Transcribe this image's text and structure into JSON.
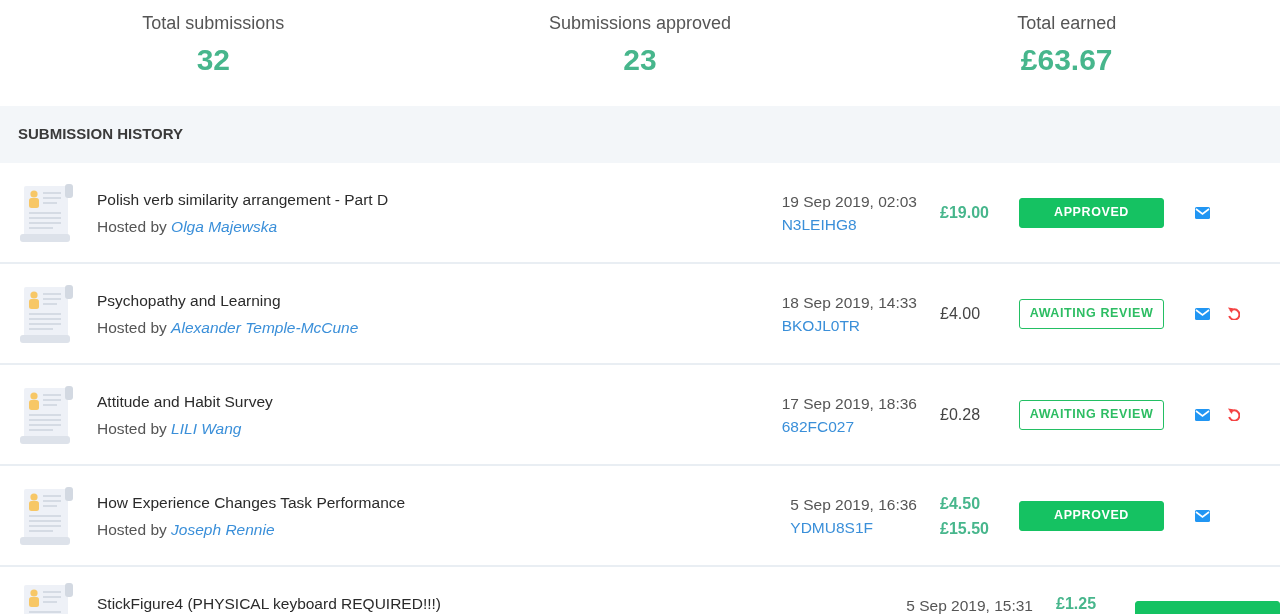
{
  "stats": [
    {
      "label": "Total submissions",
      "value": "32"
    },
    {
      "label": "Submissions approved",
      "value": "23"
    },
    {
      "label": "Total earned",
      "value": "£63.67"
    }
  ],
  "history": {
    "title": "SUBMISSION HISTORY",
    "rows": [
      {
        "title": "Polish verb similarity arrangement - Part D",
        "host_prefix": "Hosted by",
        "host": "Olga Majewska",
        "date": "19 Sep 2019, 02:03",
        "code": "N3LEIHG8",
        "amounts": [
          "£19.00"
        ],
        "badge": {
          "kind": "approved",
          "label": "APPROVED"
        },
        "actions": [
          {
            "kind": "message"
          }
        ]
      },
      {
        "title": "Psychopathy and Learning",
        "host_prefix": "Hosted by",
        "host": "Alexander Temple-McCune",
        "date": "18 Sep 2019, 14:33",
        "code": "BKOJL0TR",
        "amounts": [
          "£4.00"
        ],
        "badge": {
          "kind": "awaiting",
          "label": "AWAITING REVIEW"
        },
        "actions": [
          {
            "kind": "message"
          },
          {
            "kind": "return"
          }
        ]
      },
      {
        "title": "Attitude and Habit Survey",
        "host_prefix": "Hosted by",
        "host": "LILI Wang",
        "date": "17 Sep 2019, 18:36",
        "code": "682FC027",
        "amounts": [
          "£0.28"
        ],
        "badge": {
          "kind": "awaiting",
          "label": "AWAITING REVIEW"
        },
        "actions": [
          {
            "kind": "message"
          },
          {
            "kind": "return"
          }
        ]
      },
      {
        "title": "How Experience Changes Task Performance",
        "host_prefix": "Hosted by",
        "host": "Joseph Rennie",
        "date": "5 Sep 2019, 16:36",
        "code": "YDMU8S1F",
        "amounts": [
          "£4.50",
          "£15.50"
        ],
        "badge": {
          "kind": "approved",
          "label": "APPROVED"
        },
        "actions": [
          {
            "kind": "message"
          }
        ]
      },
      {
        "title": "StickFigure4 (PHYSICAL keyboard REQUIRED!!!)",
        "date": "5 Sep 2019, 15:31",
        "amounts": [
          "£1.25"
        ],
        "badge": {
          "kind": "approved"
        }
      }
    ]
  }
}
